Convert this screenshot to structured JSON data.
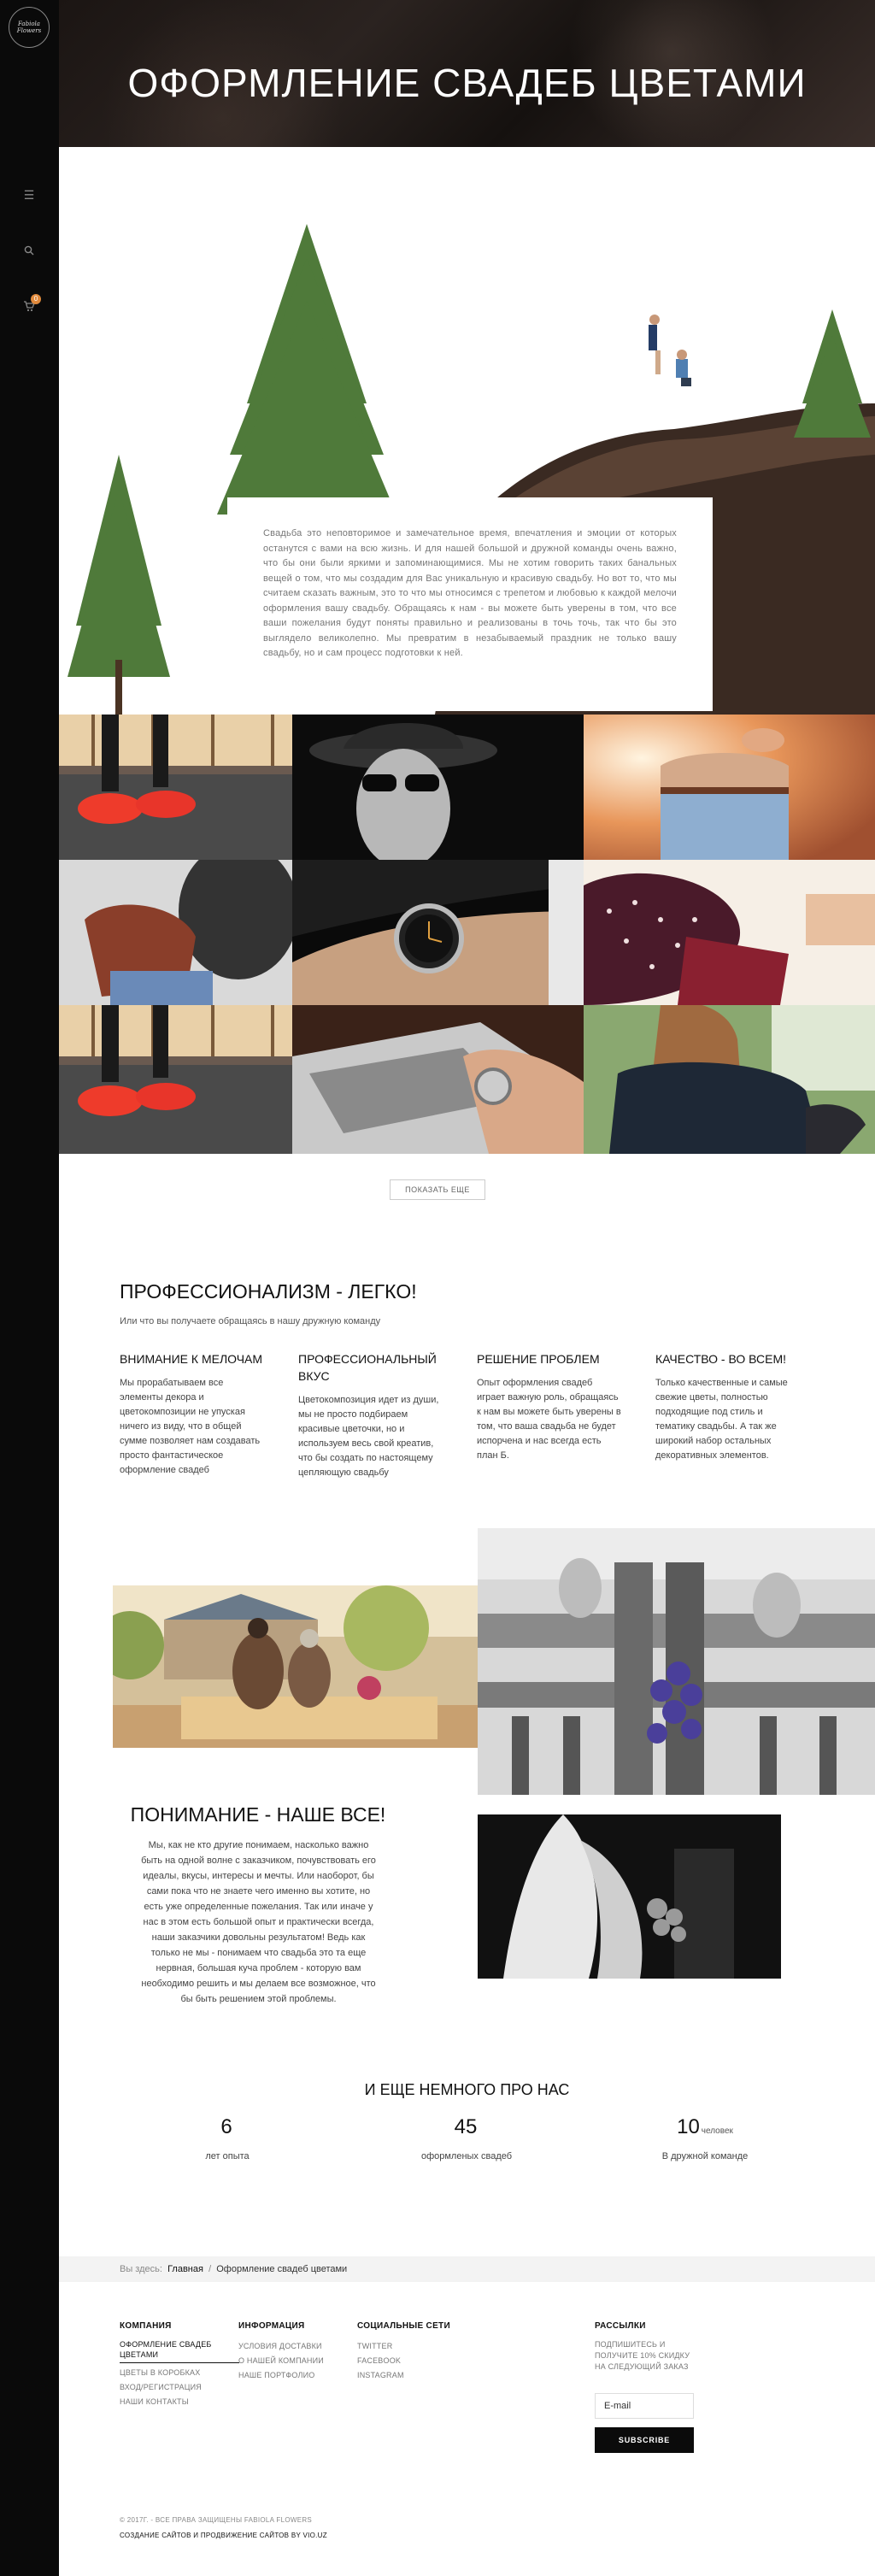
{
  "sidebar": {
    "logo_text": "Fabiola Flowers",
    "icons": [
      "menu-icon",
      "search-icon",
      "cart-icon"
    ],
    "cart_count": "0"
  },
  "hero": {
    "title": "ОФОРМЛЕНИЕ СВАДЕБ ЦВЕТАМИ"
  },
  "intro": {
    "text": "Свадьба это неповторимое и замечательное время, впечатления и эмоции от которых останутся с вами на всю жизнь. И для нашей большой и дружной команды очень важно, что бы они были яркими и запоминающимися. Мы не хотим говорить таких банальных вещей о том, что мы создадим для Вас уникальную и красивую свадьбу. Но вот то, что мы считаем сказать важным, это то что мы относимся с трепетом и любовью к каждой мелочи оформления вашу свадьбу. Обращаясь к нам - вы можете быть уверены в том, что все ваши пожелания будут поняты правильно и реализованы в точь точь, так что бы это выглядело великолепно. Мы превратим в незабываемый праздник не только вашу свадьбу, но и сам процесс подготовки к ней."
  },
  "gallery": {
    "tiles": [
      "red-sneakers",
      "hat-sunglasses",
      "jeans-hands",
      "leather-gloves",
      "wristwatch",
      "polka-dot-bag",
      "red-sneakers-2",
      "laptop-watch",
      "leather-jacket"
    ],
    "show_more": "ПОКАЗАТЬ ЕЩЕ"
  },
  "pro": {
    "title": "ПРОФЕССИОНАЛИЗМ - ЛЕГКО!",
    "subtitle": "Или что вы получаете обращаясь в нашу дружную команду",
    "columns": [
      {
        "title": "ВНИМАНИЕ К МЕЛОЧАМ",
        "text": "Мы прорабатываем все элементы декора и цветокомпозиции не упуская ничего из виду, что в общей сумме позволяет нам создавать просто фантастическое оформление свадеб"
      },
      {
        "title": "ПРОФЕССИОНАЛЬНЫЙ ВКУС",
        "text": "Цветокомпозиция идет из души, мы не просто подбираем красивые цветочки, но и используем весь свой креатив, что бы создать по настоящему цепляющую свадьбу"
      },
      {
        "title": "РЕШЕНИЕ ПРОБЛЕМ",
        "text": "Опыт оформления свадеб играет важную роль, обращаясь к нам вы можете быть уверены в том, что ваша свадьба не будет испорчена и нас всегда есть план Б."
      },
      {
        "title": "КАЧЕСТВО - ВО ВСЕМ!",
        "text": "Только качественные и самые свежие цветы, полностью подходящие под стиль и тематику свадьбы. А так же широкий набор остальных декоративных элементов."
      }
    ]
  },
  "understanding": {
    "title": "ПОНИМАНИЕ - НАШЕ ВСЕ!",
    "text": "Мы, как не кто другие понимаем, насколько важно быть на одной волне с заказчиком, почувствовать его идеалы, вкусы, интересы и мечты. Или наоборот, бы сами пока что не знаете чего именно вы хотите, но есть уже определенные пожелания. Так или иначе у нас в этом есть большой опыт и практически всегда, наши заказчики довольны результатом! Ведь как только не мы - понимаем что свадьба это та еще нервная, большая куча проблем - которую вам необходимо решить и мы делаем все возможное, что бы быть решением этой проблемы."
  },
  "stats": {
    "title": "И ЕЩЕ НЕМНОГО ПРО НАС",
    "items": [
      {
        "num": "6",
        "unit": "",
        "label": "лет опыта"
      },
      {
        "num": "45",
        "unit": "",
        "label": "оформленых свадеб"
      },
      {
        "num": "10",
        "unit": "человек",
        "label": "В дружной команде"
      }
    ]
  },
  "breadcrumb": {
    "prefix": "Вы здесь:",
    "home": "Главная",
    "sep": "/",
    "current": "Оформление свадеб цветами"
  },
  "footer": {
    "company": {
      "title": "КОМПАНИЯ",
      "links": [
        "ОФОРМЛЕНИЕ СВАДЕБ ЦВЕТАМИ",
        "ЦВЕТЫ В КОРОБКАХ",
        "ВХОД/РЕГИСТРАЦИЯ",
        "НАШИ КОНТАКТЫ"
      ]
    },
    "info": {
      "title": "ИНФОРМАЦИЯ",
      "links": [
        "УСЛОВИЯ ДОСТАВКИ",
        "О НАШЕЙ КОМПАНИИ",
        "НАШЕ ПОРТФОЛИО"
      ]
    },
    "social": {
      "title": "СОЦИАЛЬНЫЕ СЕТИ",
      "links": [
        "TWITTER",
        "FACEBOOK",
        "INSTAGRAM"
      ]
    },
    "newsletter": {
      "title": "РАССЫЛКИ",
      "text": "ПОДПИШИТЕСЬ И ПОЛУЧИТЕ 10% СКИДКУ НА СЛЕДУЮЩИЙ ЗАКАЗ",
      "email_placeholder": "E-mail",
      "button": "SUBSCRIBE"
    },
    "copyright": "© 2017Г. - ВСЕ ПРАВА ЗАЩИЩЕНЫ FABIOLA FLOWERS",
    "credit": "СОЗДАНИЕ САЙТОВ И ПРОДВИЖЕНИЕ САЙТОВ BY VIO.UZ"
  }
}
